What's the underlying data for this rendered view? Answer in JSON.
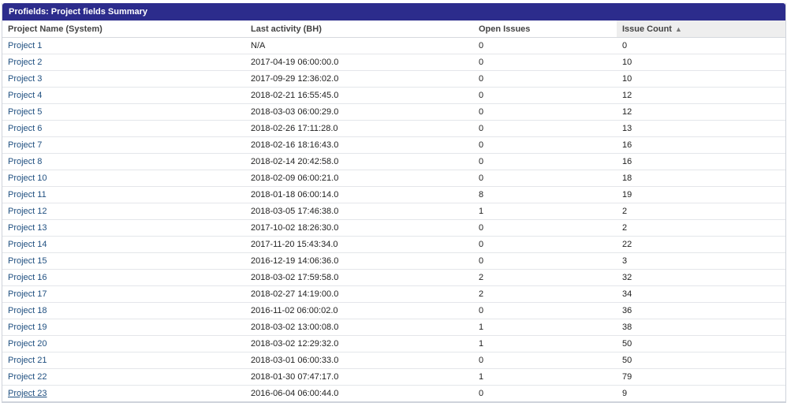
{
  "gadget": {
    "title": "Profields: Project fields Summary"
  },
  "table": {
    "headers": {
      "project_name": "Project Name (System)",
      "last_activity": "Last activity (BH)",
      "open_issues": "Open Issues",
      "issue_count": "Issue Count"
    },
    "sort_icon": "arrow-up-icon",
    "rows": [
      {
        "name": "Project 1",
        "activity": "N/A",
        "open": "0",
        "count": "0"
      },
      {
        "name": "Project 2",
        "activity": "2017-04-19 06:00:00.0",
        "open": "0",
        "count": "10"
      },
      {
        "name": "Project 3",
        "activity": "2017-09-29 12:36:02.0",
        "open": "0",
        "count": "10"
      },
      {
        "name": "Project 4",
        "activity": "2018-02-21 16:55:45.0",
        "open": "0",
        "count": "12"
      },
      {
        "name": "Project 5",
        "activity": "2018-03-03 06:00:29.0",
        "open": "0",
        "count": "12"
      },
      {
        "name": "Project 6",
        "activity": "2018-02-26 17:11:28.0",
        "open": "0",
        "count": "13"
      },
      {
        "name": "Project 7",
        "activity": "2018-02-16 18:16:43.0",
        "open": "0",
        "count": "16"
      },
      {
        "name": "Project 8",
        "activity": "2018-02-14 20:42:58.0",
        "open": "0",
        "count": "16"
      },
      {
        "name": "Project 10",
        "activity": "2018-02-09 06:00:21.0",
        "open": "0",
        "count": "18"
      },
      {
        "name": "Project 11",
        "activity": "2018-01-18 06:00:14.0",
        "open": "8",
        "count": "19"
      },
      {
        "name": "Project 12",
        "activity": "2018-03-05 17:46:38.0",
        "open": "1",
        "count": "2"
      },
      {
        "name": "Project 13",
        "activity": "2017-10-02 18:26:30.0",
        "open": "0",
        "count": "2"
      },
      {
        "name": "Project 14",
        "activity": "2017-11-20 15:43:34.0",
        "open": "0",
        "count": "22"
      },
      {
        "name": "Project 15",
        "activity": "2016-12-19 14:06:36.0",
        "open": "0",
        "count": "3"
      },
      {
        "name": "Project 16",
        "activity": "2018-03-02 17:59:58.0",
        "open": "2",
        "count": "32"
      },
      {
        "name": "Project 17",
        "activity": "2018-02-27 14:19:00.0",
        "open": "2",
        "count": "34"
      },
      {
        "name": "Project 18",
        "activity": "2016-11-02 06:00:02.0",
        "open": "0",
        "count": "36"
      },
      {
        "name": "Project 19",
        "activity": "2018-03-02 13:00:08.0",
        "open": "1",
        "count": "38"
      },
      {
        "name": "Project 20",
        "activity": "2018-03-02 12:29:32.0",
        "open": "1",
        "count": "50"
      },
      {
        "name": "Project 21",
        "activity": "2018-03-01 06:00:33.0",
        "open": "0",
        "count": "50"
      },
      {
        "name": "Project 22",
        "activity": "2018-01-30 07:47:17.0",
        "open": "1",
        "count": "79"
      },
      {
        "name": "Project 23",
        "activity": "2016-06-04 06:00:44.0",
        "open": "0",
        "count": "9"
      }
    ]
  }
}
